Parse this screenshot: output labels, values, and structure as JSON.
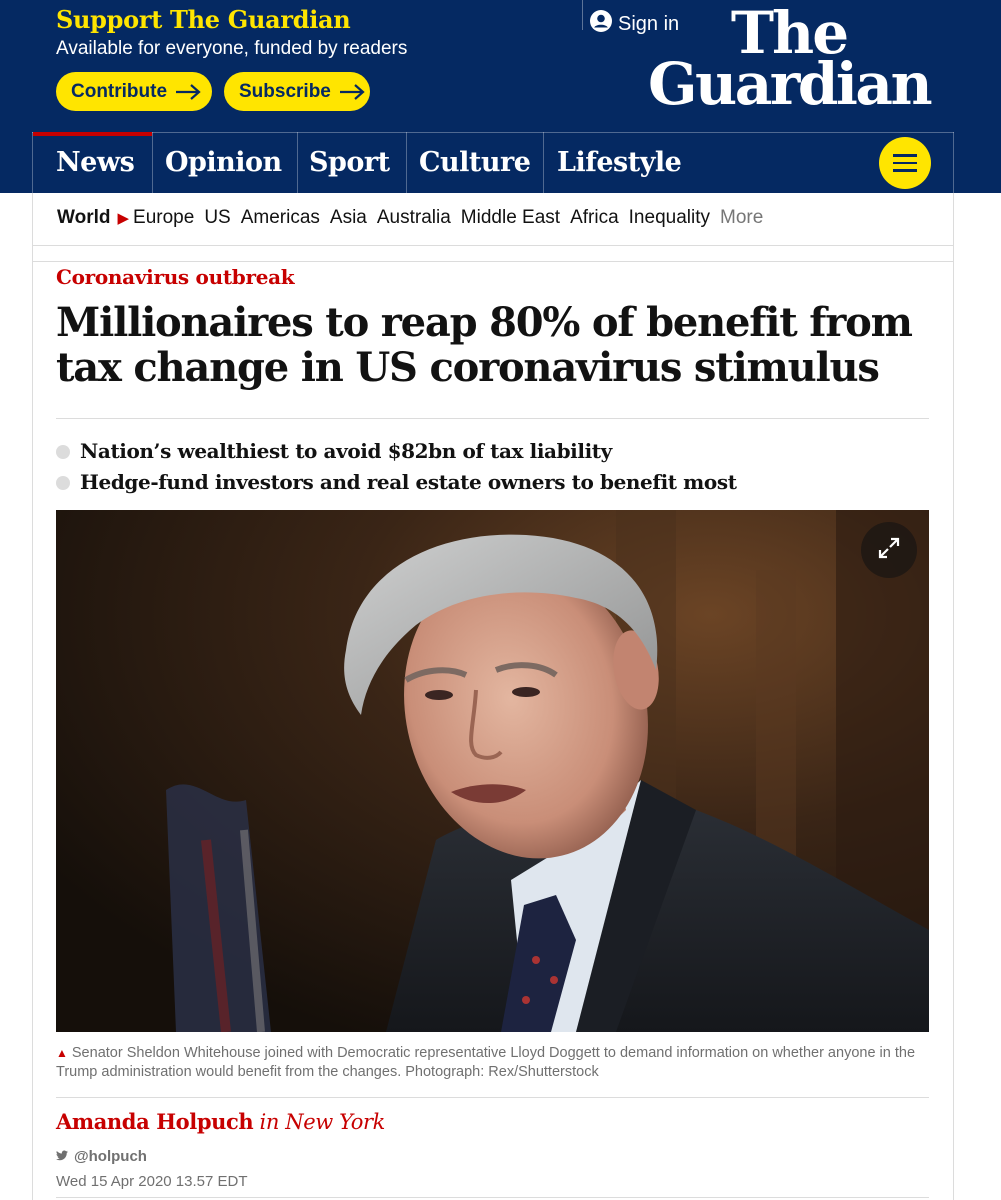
{
  "support": {
    "title": "Support The Guardian",
    "subtitle": "Available for everyone, funded by readers",
    "contribute_label": "Contribute",
    "subscribe_label": "Subscribe"
  },
  "account": {
    "signin_label": "Sign in"
  },
  "logo": {
    "line1": "The",
    "line2": "Guardian"
  },
  "pillars": [
    {
      "label": "News",
      "active": true
    },
    {
      "label": "Opinion"
    },
    {
      "label": "Sport"
    },
    {
      "label": "Culture"
    },
    {
      "label": "Lifestyle"
    }
  ],
  "subnav": {
    "current": "World",
    "items": [
      "Europe",
      "US",
      "Americas",
      "Asia",
      "Australia",
      "Middle East",
      "Africa",
      "Inequality"
    ],
    "more_label": "More"
  },
  "article": {
    "kicker": "Coronavirus outbreak",
    "headline": "Millionaires to reap 80% of benefit from tax change in US coronavirus stimulus",
    "standfirst": [
      "Nation’s wealthiest to avoid $82bn of tax liability",
      "Hedge-fund investors and real estate owners to benefit most"
    ],
    "caption": "Senator Sheldon Whitehouse joined with Democratic representative Lloyd Doggett to demand information on whether anyone in the Trump administration would benefit from the changes. Photograph: Rex/Shutterstock",
    "author_name": "Amanda Holpuch",
    "author_location": "in New York",
    "twitter_handle": "@holpuch",
    "date": "Wed 15 Apr 2020 13.57 EDT"
  },
  "colors": {
    "brand_blue": "#052962",
    "support_yellow": "#ffe500",
    "news_red": "#c70000"
  },
  "icons": [
    "user-icon",
    "arrow-right-icon",
    "menu-icon",
    "expand-icon",
    "twitter-icon",
    "caption-triangle-icon"
  ]
}
